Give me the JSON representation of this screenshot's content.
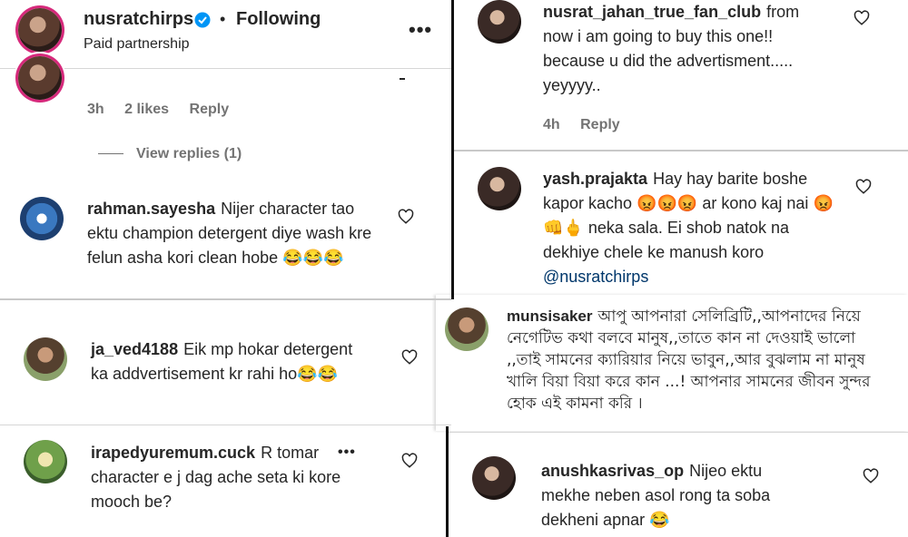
{
  "header": {
    "username": "nusratchirps",
    "verified_icon": "verified-badge-icon",
    "separator": "•",
    "following_label": "Following",
    "subtitle": "Paid partnership",
    "more_label": "•••"
  },
  "left_panel": {
    "first_meta": {
      "time": "3h",
      "likes": "2 likes",
      "reply": "Reply"
    },
    "view_replies": "View replies (1)",
    "comments": [
      {
        "user": "rahman.sayesha",
        "text": "Nijer character tao ektu champion detergent diye wash kre felun asha kori clean hobe",
        "emoji": "😂😂😂"
      },
      {
        "user": "ja_ved4188",
        "text": "Eik mp hokar detergent ka addvertisement kr rahi ho",
        "emoji": "😂😂"
      },
      {
        "user": "irapedyuremum.cuck",
        "text": "R tomar character e j dag ache seta ki kore mooch be?",
        "more_label": "•••"
      }
    ]
  },
  "right_panel": {
    "comments": [
      {
        "user": "nusrat_jahan_true_fan_club",
        "text": "from now i am going to buy this one!! because u did the advertisment..... yeyyyy..",
        "time": "4h",
        "reply": "Reply"
      },
      {
        "user": "yash.prajakta",
        "text_1": "Hay hay barite boshe kapor kacho",
        "emoji_1": "😡😡😡",
        "text_2": "ar kono kaj nai",
        "emoji_2": "😡👊🖕",
        "text_3": "neka sala. Ei shob natok na dekhiye chele ke manush koro",
        "mention": "@nusratchirps"
      },
      {
        "user": "munsisaker",
        "text": "আপু আপনারা সেলিব্রিটি,,আপনাদের নিয়ে নেগেটিভ কথা বলবে মানুষ,,তাতে কান না দেওয়াই ভালো ,,তাই সামনের ক্যারিয়ার নিয়ে ভাবুন,,আর বুঝলাম না মানুষ খালি বিয়া বিয়া করে কান ...! আপনার সামনের জীবন সুন্দর হোক এই কামনা করি ।"
      },
      {
        "user": "anushkasrivas_op",
        "text": "Nijeo ektu mekhe neben asol rong ta soba dekheni apnar",
        "emoji": "😂"
      }
    ]
  },
  "icons": {
    "like": "heart-outline-icon"
  }
}
